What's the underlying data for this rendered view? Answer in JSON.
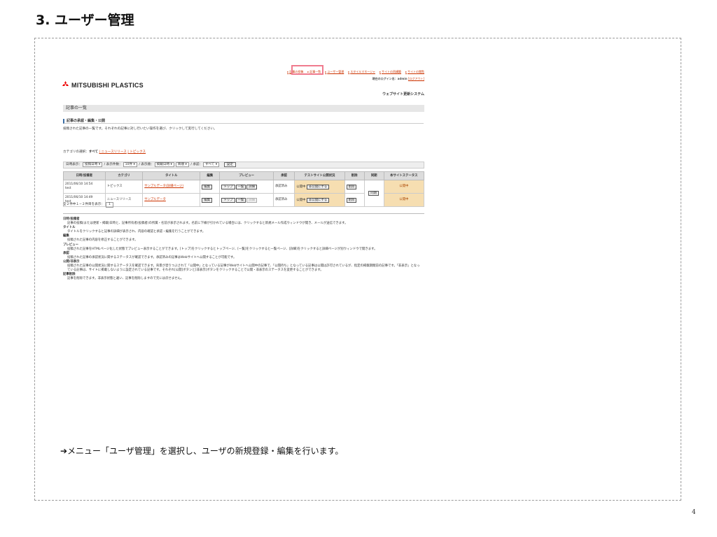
{
  "slide": {
    "title": "3. ユーザー管理",
    "page_number": "4",
    "caption": "➔メニュー「ユーザ管理」を選択し、ユーザの新規登録・編集を行います。"
  },
  "app": {
    "logo_text": "MITSUBISHI PLASTICS",
    "nav": [
      "記事の投稿",
      "記事一覧",
      "ユーザー管理",
      "スタイルマネージャ",
      "サイトの再構築",
      "サイトの閲覧"
    ],
    "login_label": "現在のログイン名：admin",
    "logout": "[ログアウト]",
    "system_name": "ウェブサイト更新システム",
    "section_title": "記事の一覧",
    "sub_heading": "記事の承認・編集・公開",
    "description": "投稿された記事の一覧です。それぞれの記事に対し行いたい操作を選び、クリックして実行してください。",
    "category": {
      "label": "カテゴリの選択：",
      "all": "すべて",
      "links": [
        "| ニュースリリース",
        "| トピックス"
      ]
    },
    "filter": {
      "date_label": "日時表示：",
      "date_value": "投稿日時",
      "count_label": "/ 表示件数：",
      "count_value": "10件",
      "order_label": "/ 表示順：",
      "order_value": "掲載日時",
      "dir_value": "降順",
      "approve_label": "/ 承認：",
      "approve_value": "すべて",
      "set_button": "設定"
    },
    "columns": [
      "日時/投稿者",
      "カテゴリ",
      "タイトル",
      "編集",
      "プレビュー",
      "承認",
      "テストサイト公開状況",
      "削除",
      "同期",
      "本サイトステータス"
    ],
    "rows": [
      {
        "date": "2011/06/10 14:54",
        "author": "test",
        "category": "トピックス",
        "title": "サンプルデータ(詳細ページ)",
        "approval": "承認済み",
        "status": "公開中",
        "site_status": "公開中"
      },
      {
        "date": "2011/06/10 14:49",
        "author": "test",
        "category": "ニュースリリース",
        "title": "サンプルデータ",
        "approval": "承認済み",
        "status": "公開中",
        "site_status": "公開中"
      }
    ],
    "buttons": {
      "edit": "編集",
      "top": "トップ",
      "list": "一覧",
      "detail": "詳細",
      "private": "非公開にする",
      "delete": "削除",
      "sync": "同期"
    },
    "count_text": "全２件中１−２件目を表示：",
    "page": "1",
    "help": [
      {
        "title": "日時/投稿者",
        "body": "記事の投稿(または更新・掲載)日時と、記事所有者(投稿者)の所属・名前が表示されます。名前に下線が引かれている場合には、クリックすると新規メール作成ウィンドウが開き、メールが送信できます。"
      },
      {
        "title": "タイトル",
        "body": "タイトルをクリックすると記事の詳細が表示され、内容の確認と承認・編集を行うことができます。"
      },
      {
        "title": "編集",
        "body": "投稿された記事の内容を修正することができます。"
      },
      {
        "title": "プレビュー",
        "body": "投稿された記事をHTMLページ化した状態でプレビュー表示することができます。[トップ]をクリックするとトップページ、[一覧]をクリックすると一覧ページ、[詳細]をクリックすると詳細ページが別ウィンドウで開きます。"
      },
      {
        "title": "承認",
        "body": "投稿された記事の承認状況に関するステータスが確認できます。承認済みの記事はWebサイトへ公開することが可能です。"
      },
      {
        "title": "公開/非表示",
        "body": "投稿された記事の公開状況に関するステータスを確認できます。背景が塗りつぶされて「公開中」となっている記事がWebサイトへ公開中の記事で、「公開待ち」となっている記事は公開は許可されているが、指定の掲載期間前の記事です。「非表示」となっている記事は、サイトに掲載しないように設定されている記事です。それぞれ[公開]ボタンと[非表示]ボタンをクリックすることで公開・非表示のステータスを変更することができます。"
      },
      {
        "title": "記事削除",
        "body": "記事を削除できます。非表示状態と違い、記事を削除しますので元には戻せません。"
      }
    ]
  }
}
